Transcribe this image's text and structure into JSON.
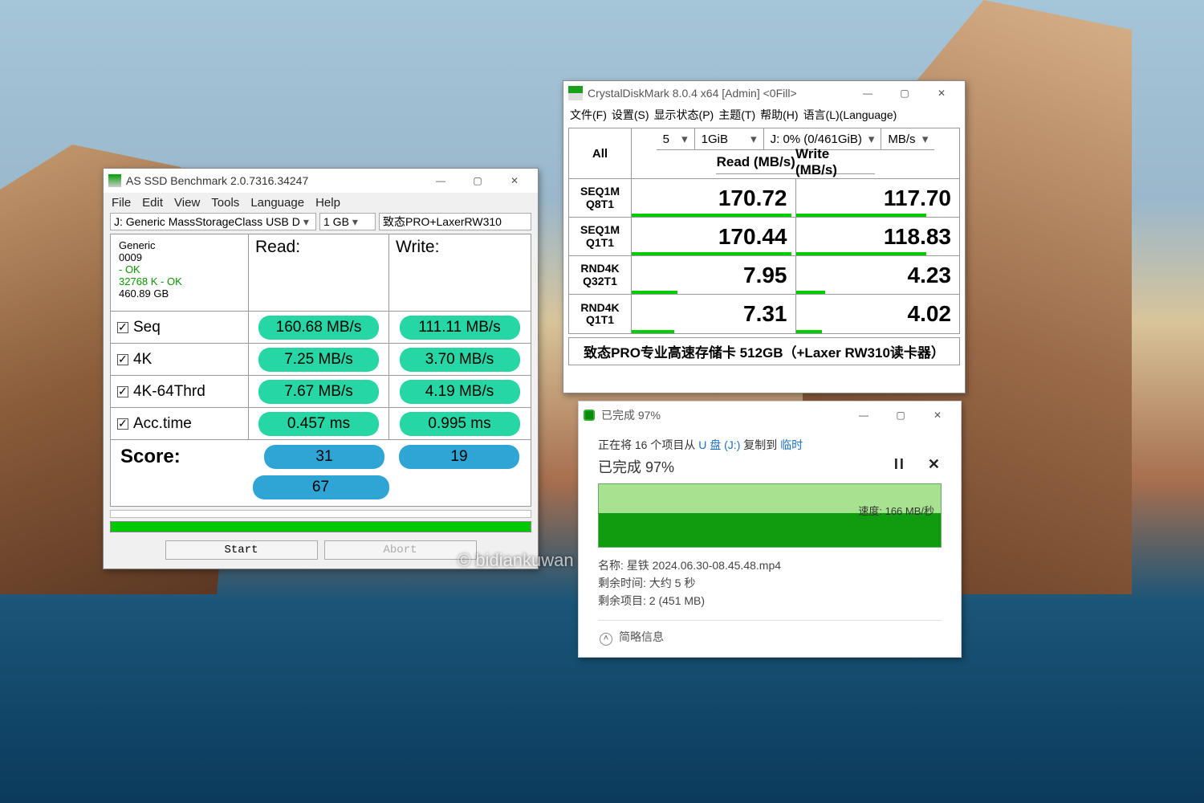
{
  "asssd": {
    "title": "AS SSD Benchmark 2.0.7316.34247",
    "menu": [
      "File",
      "Edit",
      "View",
      "Tools",
      "Language",
      "Help"
    ],
    "drive_sel": "J: Generic MassStorageClass USB D",
    "size_sel": "1 GB",
    "name_field": "致态PRO+LaxerRW310",
    "info": {
      "l1": "Generic",
      "l2": "0009",
      "l3": " - OK",
      "l4": "32768 K - OK",
      "l5": "460.89 GB"
    },
    "head_read": "Read:",
    "head_write": "Write:",
    "rows": [
      {
        "label": "Seq",
        "read": "160.68 MB/s",
        "write": "111.11 MB/s"
      },
      {
        "label": "4K",
        "read": "7.25 MB/s",
        "write": "3.70 MB/s"
      },
      {
        "label": "4K-64Thrd",
        "read": "7.67 MB/s",
        "write": "4.19 MB/s"
      },
      {
        "label": "Acc.time",
        "read": "0.457 ms",
        "write": "0.995 ms"
      }
    ],
    "score_label": "Score:",
    "score_read": "31",
    "score_write": "19",
    "score_total": "67",
    "btn_start": "Start",
    "btn_abort": "Abort"
  },
  "cdm": {
    "title": "CrystalDiskMark 8.0.4 x64 [Admin] <0Fill>",
    "menu": [
      "文件(F)",
      "设置(S)",
      "显示状态(P)",
      "主题(T)",
      "帮助(H)",
      "语言(L)(Language)"
    ],
    "all": "All",
    "sel_count": "5",
    "sel_size": "1GiB",
    "sel_drive": "J: 0% (0/461GiB)",
    "sel_unit": "MB/s",
    "h_read": "Read (MB/s)",
    "h_write": "Write (MB/s)",
    "rows": [
      {
        "l1": "SEQ1M",
        "l2": "Q8T1",
        "read": "170.72",
        "write": "117.70",
        "rb": 98,
        "wb": 80
      },
      {
        "l1": "SEQ1M",
        "l2": "Q1T1",
        "read": "170.44",
        "write": "118.83",
        "rb": 98,
        "wb": 80
      },
      {
        "l1": "RND4K",
        "l2": "Q32T1",
        "read": "7.95",
        "write": "4.23",
        "rb": 28,
        "wb": 18
      },
      {
        "l1": "RND4K",
        "l2": "Q1T1",
        "read": "7.31",
        "write": "4.02",
        "rb": 26,
        "wb": 16
      }
    ],
    "footer": "致态PRO专业高速存储卡 512GB（+Laxer RW310读卡器）"
  },
  "fcopy": {
    "title": "已完成 97%",
    "line1a": "正在将 16 个项目从 ",
    "line1b": "U 盘 (J:)",
    "line1c": " 复制到 ",
    "line1d": "临时",
    "pct": "已完成 97%",
    "speed": "速度: 166 MB/秒",
    "d1": "名称: 星铁 2024.06.30-08.45.48.mp4",
    "d2": "剩余时间: 大约 5 秒",
    "d3": "剩余项目: 2 (451 MB)",
    "less": "简略信息"
  },
  "watermark": "© bidiankuwan"
}
